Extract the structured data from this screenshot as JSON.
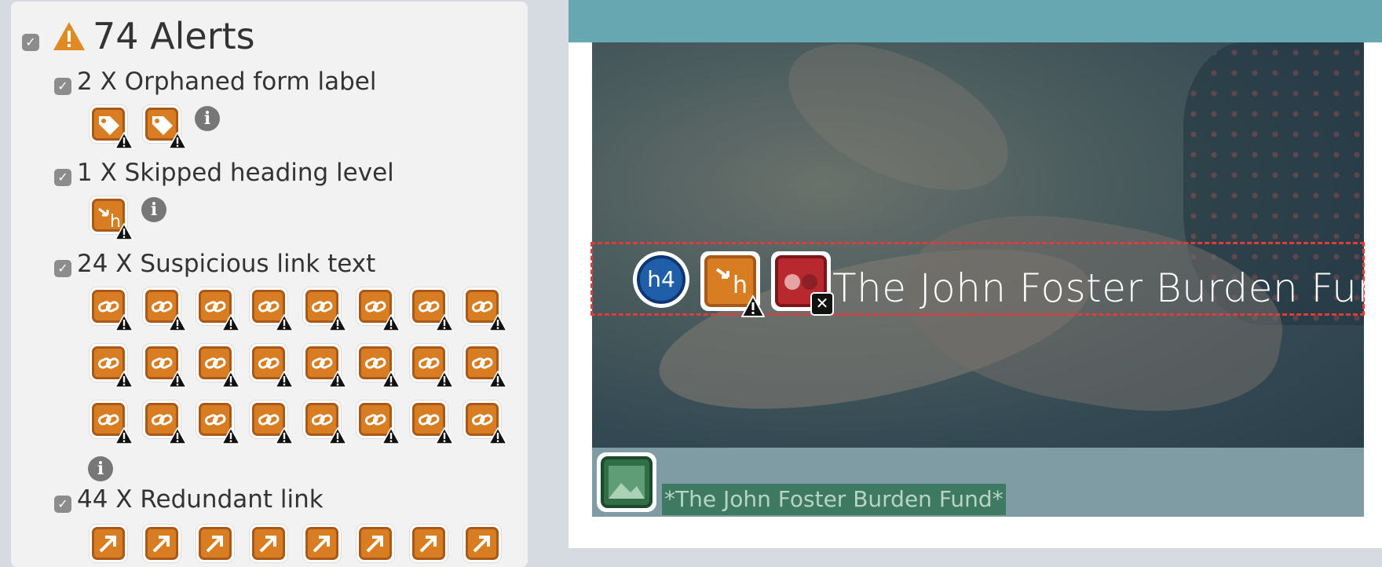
{
  "panel": {
    "title": "74 Alerts",
    "groups": [
      {
        "label": "2 X Orphaned form label",
        "icon": "tag-warning-icon",
        "count": 2
      },
      {
        "label": "1 X Skipped heading level",
        "icon": "skipped-heading-warning-icon",
        "count": 1
      },
      {
        "label": "24 X Suspicious link text",
        "icon": "link-warning-icon",
        "count": 24
      },
      {
        "label": "44 X Redundant link",
        "icon": "redundant-link-icon",
        "count": 44
      }
    ],
    "info_glyph": "i"
  },
  "page": {
    "hero_heading": "The John Foster Burden Fund",
    "heading_badge": "h4",
    "image_alt_text": "*The John Foster Burden Fund*"
  },
  "colors": {
    "alert_orange": "#d97d22",
    "topbar_teal": "#66a7b1",
    "heading_blue": "#1f5ea8",
    "error_red": "#b8292f",
    "image_green": "#2f6e46",
    "outline_red": "#e03c3c"
  }
}
